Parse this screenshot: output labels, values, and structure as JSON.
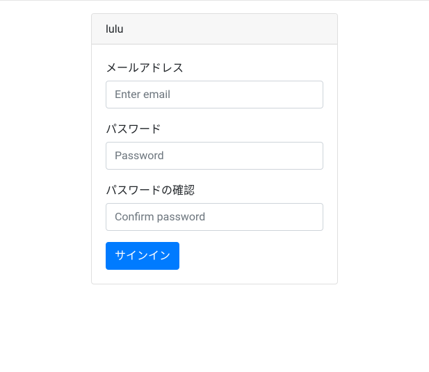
{
  "card": {
    "title": "lulu"
  },
  "form": {
    "email": {
      "label": "メールアドレス",
      "placeholder": "Enter email"
    },
    "password": {
      "label": "パスワード",
      "placeholder": "Password"
    },
    "confirm_password": {
      "label": "パスワードの確認",
      "placeholder": "Confirm password"
    },
    "submit_label": "サインイン"
  }
}
